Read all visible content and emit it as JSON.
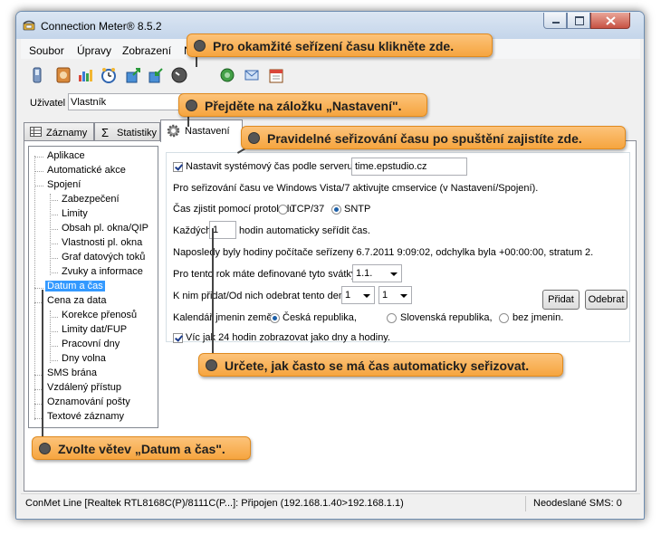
{
  "window": {
    "title": "Connection Meter® 8.5.2"
  },
  "menu": {
    "items": [
      "Soubor",
      "Úpravy",
      "Zobrazení",
      "Ná"
    ]
  },
  "toolbar": {
    "icons": [
      "phone-icon",
      "connection-icon",
      "chart-icon",
      "clock-icon",
      "export-icon",
      "import-icon",
      "time-sync-icon",
      "network-icon",
      "mail-icon",
      "calendar-icon"
    ]
  },
  "user": {
    "label": "Uživatel",
    "value": "Vlastník"
  },
  "tabs": [
    {
      "label": "Záznamy"
    },
    {
      "label": "Statistiky"
    },
    {
      "label": "Nastavení"
    }
  ],
  "tree": {
    "items": [
      "Aplikace",
      "Automatické akce",
      "Spojení",
      "Zabezpečení",
      "Limity",
      "Obsah pl. okna/QIP",
      "Vlastnosti pl. okna",
      "Graf datových toků",
      "Zvuky a informace",
      "Datum a čas",
      "Cena za data",
      "Korekce přenosů",
      "Limity dat/FUP",
      "Pracovní dny",
      "Dny volna",
      "SMS brána",
      "Vzdálený přístup",
      "Oznamování pošty",
      "Textové záznamy"
    ],
    "selected": "Datum a čas"
  },
  "settings": {
    "sync_label": "Nastavit systémový čas podle serveru",
    "sync_checked": true,
    "server": "time.epstudio.cz",
    "vista_note": "Pro seřizování času ve Windows Vista/7 aktivujte cmservice (v Nastavení/Spojení).",
    "protocol_label": "Čas zjistit pomocí protokolu",
    "protocol_tcp": "TCP/37",
    "protocol_sntp": "SNTP",
    "protocol_selected": "SNTP",
    "every_prefix": "Každých",
    "every_value": "1",
    "every_suffix": "hodin automaticky seřídit čas.",
    "last_sync": "Naposledy byly hodiny počítače seřízeny 6.7.2011 9:09:02, odchylka byla +00:00:00, stratum 2.",
    "holidays_label": "Pro tento rok máte definované tyto svátky",
    "holidays_value": "1.1.",
    "add_label": "K nim přidat/Od nich odebrat tento den",
    "day_value": "1",
    "month_value": "1",
    "add_button": "Přidat",
    "remove_button": "Odebrat",
    "calendar_label": "Kalendář jmenin země",
    "country_cz": "Česká republika,",
    "country_sk": "Slovenská republika,",
    "country_none": "bez jmenin.",
    "country_selected": "Česká republika",
    "hours_label": "Víc jak 24 hodin zobrazovat jako dny a hodiny.",
    "hours_checked": true
  },
  "status": {
    "connection": "ConMet Line [Realtek RTL8168C(P)/8111C(P...]: Připojen (192.168.1.40>192.168.1.1)",
    "sms": "Neodeslané SMS: 0"
  },
  "callouts": {
    "sync_now": "Pro okamžité seřízení času klikněte zde.",
    "settings_tab": "Přejděte na záložku „Nastavení\".",
    "on_startup": "Pravidelné seřizování času po spuštění zajistíte zde.",
    "interval": "Určete, jak často se má čas automaticky seřizovat.",
    "branch": "Zvolte větev „Datum a čas\"."
  },
  "colors": {
    "callout": "#f9b45a",
    "selection": "#3399ff",
    "window_frame": "#c4d5ea"
  }
}
